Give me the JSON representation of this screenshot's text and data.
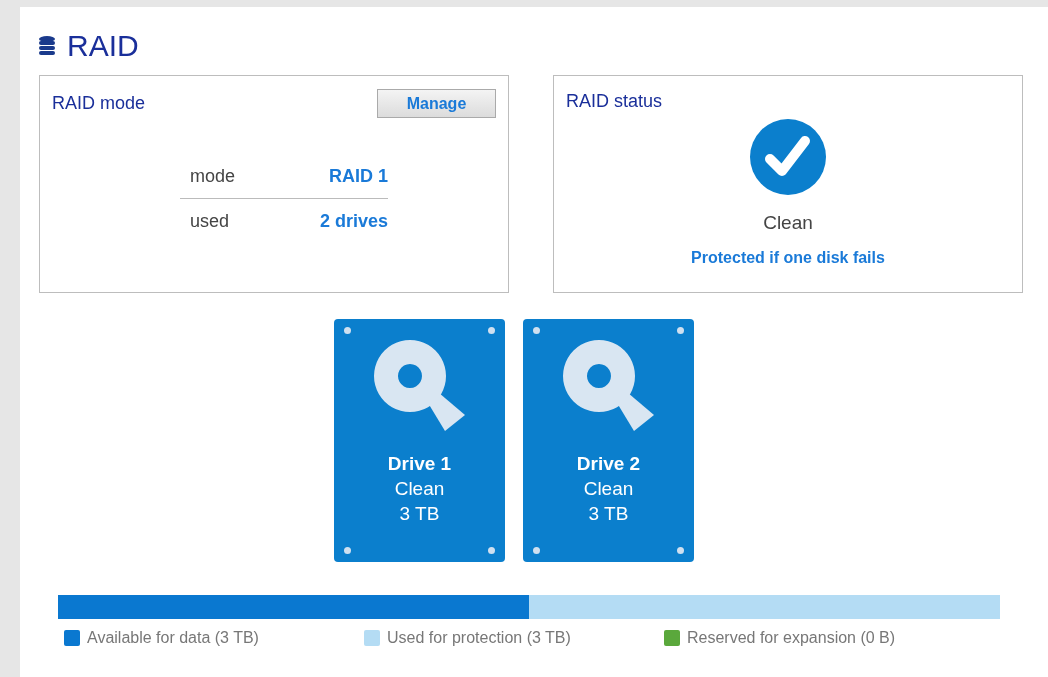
{
  "page_title": "RAID",
  "raid_mode": {
    "title": "RAID mode",
    "button": "Manage",
    "rows": [
      {
        "label": "mode",
        "value": "RAID 1"
      },
      {
        "label": "used",
        "value": "2 drives"
      }
    ]
  },
  "raid_status": {
    "title": "RAID status",
    "status": "Clean",
    "note": "Protected if one disk fails"
  },
  "drives": [
    {
      "name": "Drive 1",
      "status": "Clean",
      "size": "3 TB"
    },
    {
      "name": "Drive 2",
      "status": "Clean",
      "size": "3 TB"
    }
  ],
  "storage": [
    {
      "label": "Available for data (3 TB)",
      "color": "#0a78d0",
      "level": 0.5
    },
    {
      "label": "Used for protection (3 TB)",
      "color": "#b4dcf4",
      "level": 0.5
    },
    {
      "label": "Reserved for expansion (0 B)",
      "color": "#5aa83c"
    }
  ]
}
